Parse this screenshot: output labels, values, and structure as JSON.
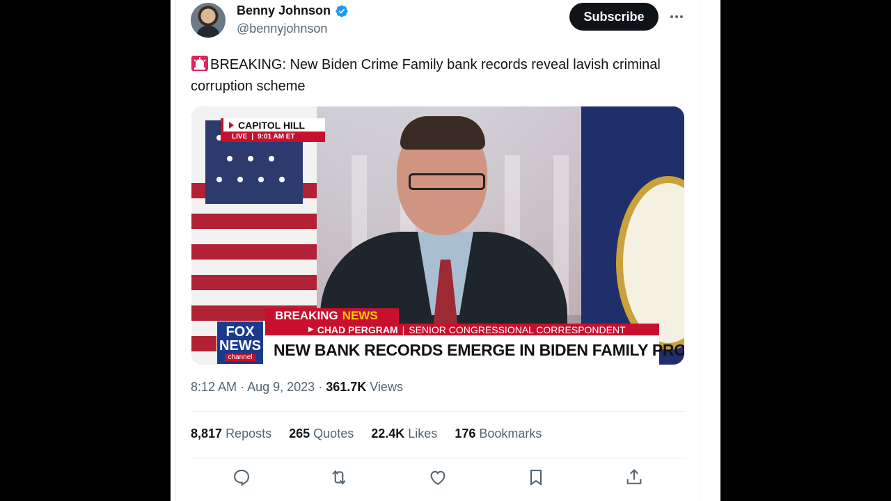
{
  "author": {
    "display_name": "Benny Johnson",
    "handle": "@bennyjohnson",
    "verified": true
  },
  "header": {
    "subscribe_label": "Subscribe"
  },
  "tweet": {
    "emoji": "siren-icon",
    "text": "BREAKING: New Biden Crime Family bank records reveal lavish criminal corruption scheme"
  },
  "media": {
    "location_bug": "CAPITOL HILL",
    "live_label": "LIVE",
    "live_time": "9:01 AM ET",
    "breaking_label": "BREAKING",
    "news_label": "NEWS",
    "reporter_name": "CHAD PERGRAM",
    "reporter_title": "SENIOR CONGRESSIONAL CORRESPONDENT",
    "headline": "NEW BANK RECORDS EMERGE IN BIDEN FAMILY PROBE",
    "logo_line1": "FOX",
    "logo_line2": "NEWS",
    "logo_line3": "channel"
  },
  "meta": {
    "time": "8:12 AM",
    "date": "Aug 9, 2023",
    "views_count": "361.7K",
    "views_label": "Views"
  },
  "stats": [
    {
      "count": "8,817",
      "label": "Reposts"
    },
    {
      "count": "265",
      "label": "Quotes"
    },
    {
      "count": "22.4K",
      "label": "Likes"
    },
    {
      "count": "176",
      "label": "Bookmarks"
    }
  ],
  "actions": [
    "reply-icon",
    "repost-icon",
    "like-icon",
    "bookmark-icon",
    "share-icon"
  ],
  "colors": {
    "accent_verified": "#1d9bf0",
    "text_primary": "#0f1419",
    "text_secondary": "#536471",
    "fox_red": "#c8102e"
  }
}
